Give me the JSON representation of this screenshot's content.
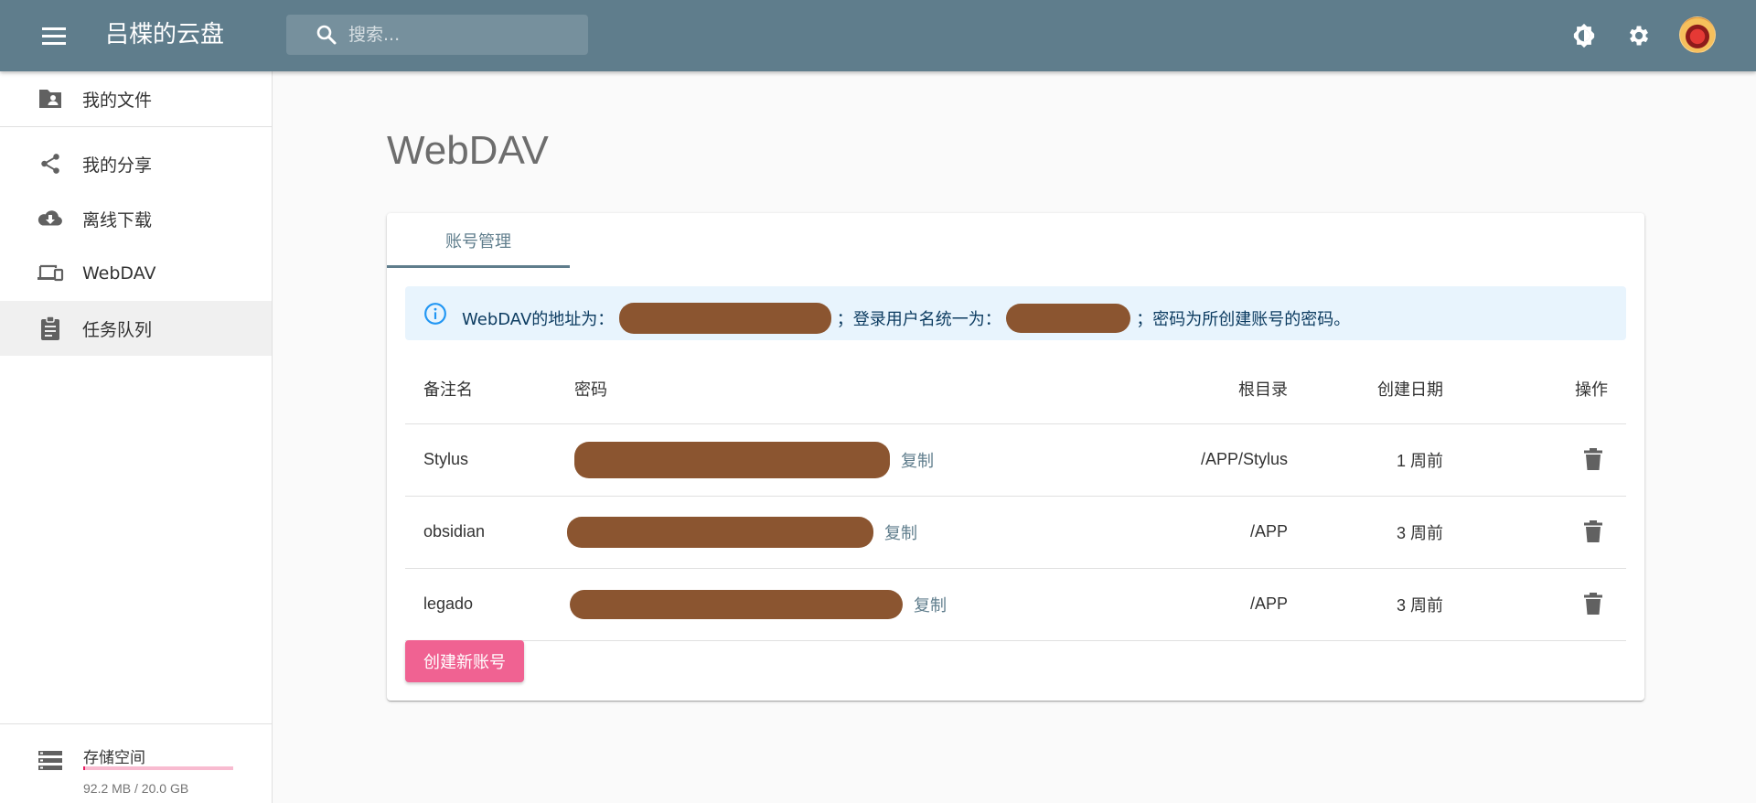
{
  "app": {
    "title": "吕楪的云盘",
    "search_placeholder": "搜索...",
    "icons": {
      "menu": "menu-icon",
      "search": "search-icon",
      "theme": "brightness-icon",
      "settings": "gear-icon",
      "avatar": "avatar"
    }
  },
  "sidebar": {
    "items": [
      {
        "label": "我的文件",
        "icon": "folder-account-icon"
      },
      {
        "label": "我的分享",
        "icon": "share-icon"
      },
      {
        "label": "离线下载",
        "icon": "cloud-download-icon"
      },
      {
        "label": "WebDAV",
        "icon": "devices-icon"
      },
      {
        "label": "任务队列",
        "icon": "clipboard-icon"
      }
    ],
    "storage": {
      "title": "存储空间",
      "used_text": "92.2 MB / 20.0 GB",
      "used_fraction": 0.0045
    }
  },
  "page": {
    "title": "WebDAV",
    "tab": "账号管理",
    "alert": {
      "prefix": "WebDAV的地址为：",
      "middle": "；登录用户名统一为：",
      "suffix": "；密码为所创建账号的密码。"
    },
    "table": {
      "headers": [
        "备注名",
        "密码",
        "根目录",
        "创建日期",
        "操作"
      ],
      "rows": [
        {
          "name": "Stylus",
          "copy": "复制",
          "root": "/APP/Stylus",
          "created": "1 周前"
        },
        {
          "name": "obsidian",
          "copy": "复制",
          "root": "/APP",
          "created": "3 周前"
        },
        {
          "name": "legado",
          "copy": "复制",
          "root": "/APP",
          "created": "3 周前"
        }
      ]
    },
    "create_button": "创建新账号"
  },
  "colors": {
    "appbar": "#5f7d8c",
    "accent": "#f06292",
    "alert_bg": "#e8f4fd",
    "info_icon": "#2196f3"
  }
}
